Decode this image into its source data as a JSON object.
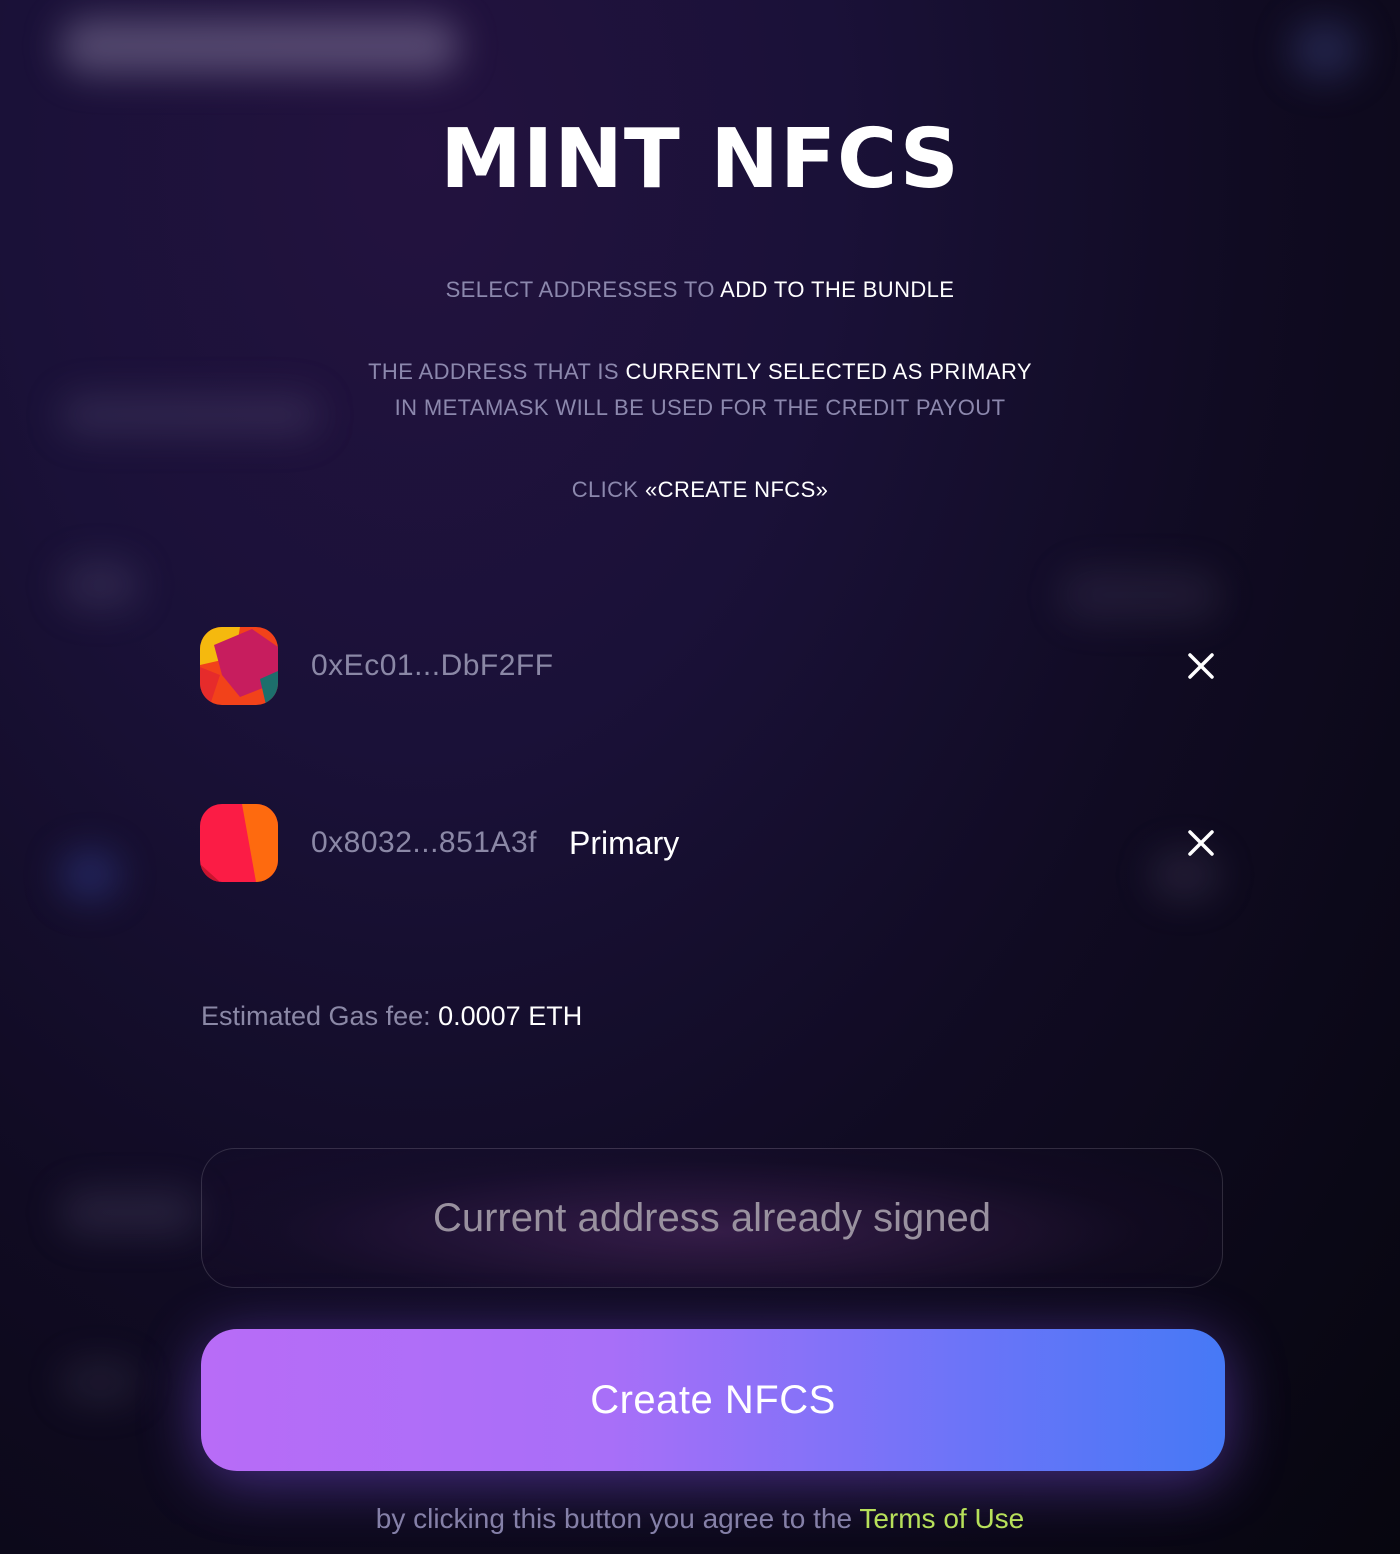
{
  "page": {
    "title": "MINT NFCS",
    "instructions": {
      "step1": {
        "dim": "SELECT ADDRESSES TO ",
        "bright": "ADD TO THE BUNDLE"
      },
      "step2": {
        "line1_dim": "THE ADDRESS THAT IS ",
        "line1_bright": "CURRENTLY SELECTED AS PRIMARY",
        "line2_dim": "IN METAMASK WILL BE USED FOR THE CREDIT PAYOUT"
      },
      "step3": {
        "dim": "CLICK ",
        "bright": "«CREATE NFCS»"
      }
    }
  },
  "addresses": [
    {
      "address": "0xEc01...DbF2FF",
      "primary_label": "",
      "avatar_icon": "identicon-red-pink-orange"
    },
    {
      "address": "0x8032...851A3f",
      "primary_label": "Primary",
      "avatar_icon": "identicon-red-orange"
    }
  ],
  "gas": {
    "label": "Estimated Gas fee: ",
    "value": "0.0007 ETH"
  },
  "signed_status": {
    "text": "Current address already signed"
  },
  "create_button": {
    "label": "Create NFCS"
  },
  "terms": {
    "text": "by clicking this button you agree to the ",
    "link": "Terms of Use",
    "link_color": "#b7e05a"
  },
  "colors": {
    "dim_text": "#8c88ad",
    "button_gradient_start": "#b86cf7",
    "button_gradient_end": "#4679f6"
  }
}
